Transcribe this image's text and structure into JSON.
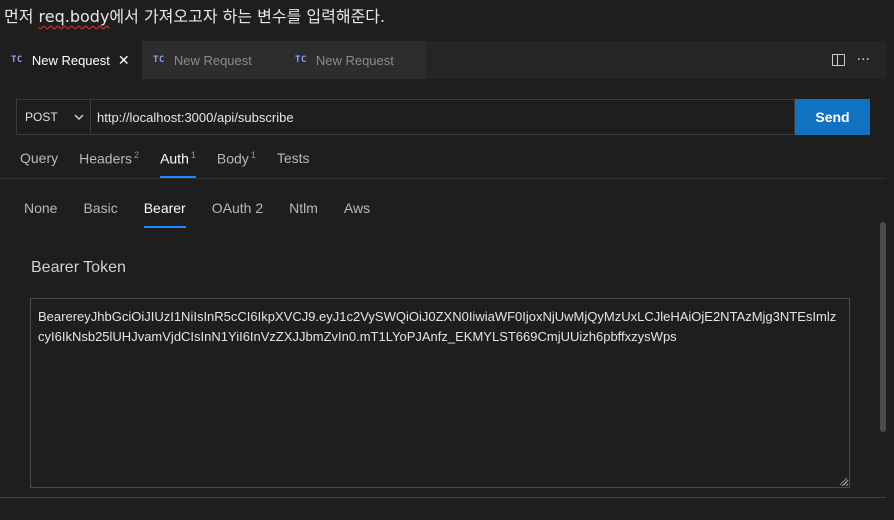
{
  "caption": {
    "prefix": "먼저 ",
    "highlight": "req.body",
    "suffix": "에서 가져오고자 하는 변수를 입력해준다."
  },
  "tabs": [
    {
      "badge": "TC",
      "label": "New Request",
      "active": true,
      "close": "✕"
    },
    {
      "badge": "TC",
      "label": "New Request",
      "active": false
    },
    {
      "badge": "TC",
      "label": "New Request",
      "active": false
    }
  ],
  "tab_actions": {
    "more": "···"
  },
  "request": {
    "method": "POST",
    "url": "http://localhost:3000/api/subscribe",
    "send_label": "Send"
  },
  "request_tabs": [
    {
      "label": "Query",
      "count": ""
    },
    {
      "label": "Headers",
      "count": "2"
    },
    {
      "label": "Auth",
      "count": "1",
      "active": true
    },
    {
      "label": "Body",
      "count": "1"
    },
    {
      "label": "Tests",
      "count": ""
    }
  ],
  "auth_tabs": [
    {
      "label": "None"
    },
    {
      "label": "Basic"
    },
    {
      "label": "Bearer",
      "active": true
    },
    {
      "label": "OAuth 2"
    },
    {
      "label": "Ntlm"
    },
    {
      "label": "Aws"
    }
  ],
  "bearer": {
    "label": "Bearer Token",
    "token": "BearereyJhbGciOiJIUzI1NiIsInR5cCI6IkpXVCJ9.eyJ1c2VySWQiOiJ0ZXN0IiwiaWF0IjoxNjUwMjQyMzUxLCJleHAiOjE2NTAzMjg3NTEsImlzcyI6IkNsb25lUHJvamVjdCIsInN1YiI6InVzZXJJbmZvIn0.mT1LYoPJAnfz_EKMYLST669CmjUUizh6pbffxzysWps"
  },
  "colors": {
    "accent": "#1a8cff",
    "send": "#1172c2",
    "badge": "#8aa2ff"
  }
}
